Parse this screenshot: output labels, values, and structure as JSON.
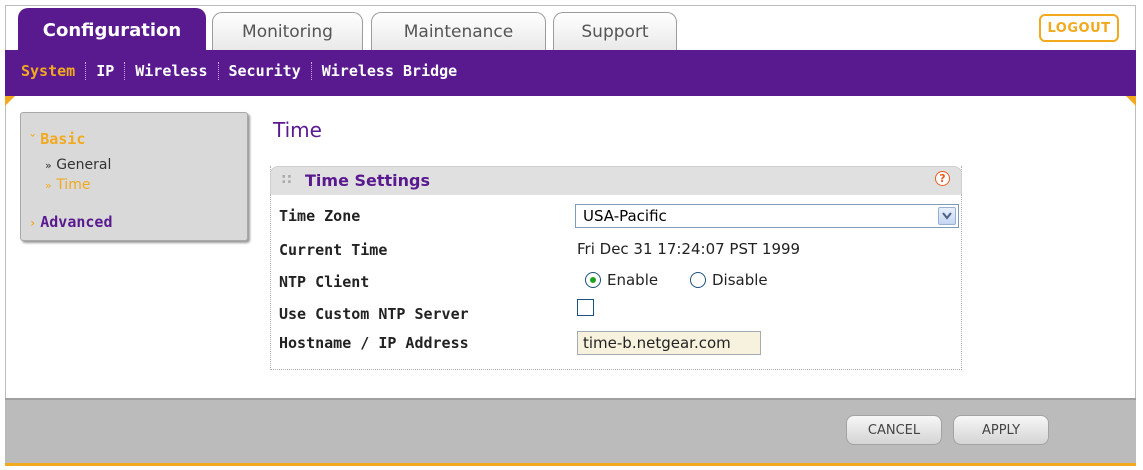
{
  "tabs": [
    {
      "label": "Configuration",
      "active": true
    },
    {
      "label": "Monitoring"
    },
    {
      "label": "Maintenance"
    },
    {
      "label": "Support"
    }
  ],
  "logout_label": "LOGOUT",
  "subnav": [
    {
      "label": "System",
      "active": true
    },
    {
      "label": "IP"
    },
    {
      "label": "Wireless"
    },
    {
      "label": "Security"
    },
    {
      "label": "Wireless Bridge"
    }
  ],
  "sidebar": {
    "basic": "Basic",
    "general": "General",
    "time": "Time",
    "advanced": "Advanced"
  },
  "page_title": "Time",
  "settings": {
    "section_title": "Time Settings",
    "time_zone_label": "Time Zone",
    "time_zone_value": "USA-Pacific",
    "current_time_label": "Current Time",
    "current_time_value": "Fri Dec 31 17:24:07 PST 1999",
    "ntp_client_label": "NTP Client",
    "ntp_enable": "Enable",
    "ntp_disable": "Disable",
    "ntp_selected": "Enable",
    "custom_ntp_label": "Use Custom NTP Server",
    "custom_ntp_checked": false,
    "hostname_label": "Hostname / IP Address",
    "hostname_value": "time-b.netgear.com"
  },
  "buttons": {
    "cancel": "CANCEL",
    "apply": "APPLY"
  },
  "colors": {
    "brand_purple": "#5a1a8f",
    "accent_orange": "#f2a91e"
  },
  "icons": [
    "help-icon",
    "chevron-down-icon",
    "sidebar-arrow-icon"
  ]
}
